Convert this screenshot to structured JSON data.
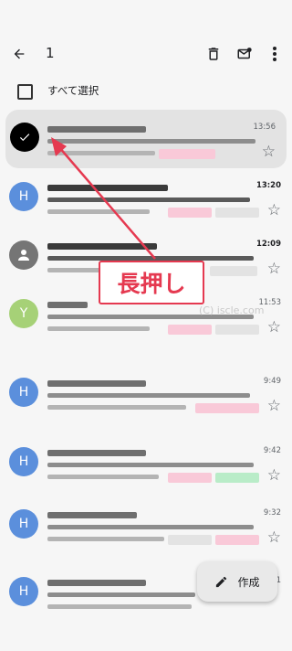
{
  "header": {
    "selected_count": "1"
  },
  "select_all": {
    "label": "すべて選択"
  },
  "callout": {
    "text": "長押し"
  },
  "watermark": {
    "text": "(C) iscle.com"
  },
  "compose": {
    "label": "作成"
  },
  "colors": {
    "avatar_blue": "#5b8fdc",
    "avatar_gray": "#757575",
    "avatar_green": "#a6d177",
    "accent_red": "#e53950",
    "tag_pink": "#f9c9d8",
    "tag_gray": "#e3e3e3",
    "tag_green": "#b9ecc8"
  },
  "emails": [
    {
      "avatar": "",
      "time": "13:56",
      "unread": false,
      "selected": true
    },
    {
      "avatar": "H",
      "time": "13:20",
      "unread": true,
      "selected": false
    },
    {
      "avatar": "",
      "time": "12:09",
      "unread": true,
      "selected": false
    },
    {
      "avatar": "Y",
      "time": "11:53",
      "unread": false,
      "selected": false
    },
    {
      "avatar": "H",
      "time": "9:49",
      "unread": false,
      "selected": false
    },
    {
      "avatar": "H",
      "time": "9:42",
      "unread": false,
      "selected": false
    },
    {
      "avatar": "H",
      "time": "9:32",
      "unread": false,
      "selected": false
    },
    {
      "avatar": "H",
      "time": "9:31",
      "unread": false,
      "selected": false
    }
  ]
}
